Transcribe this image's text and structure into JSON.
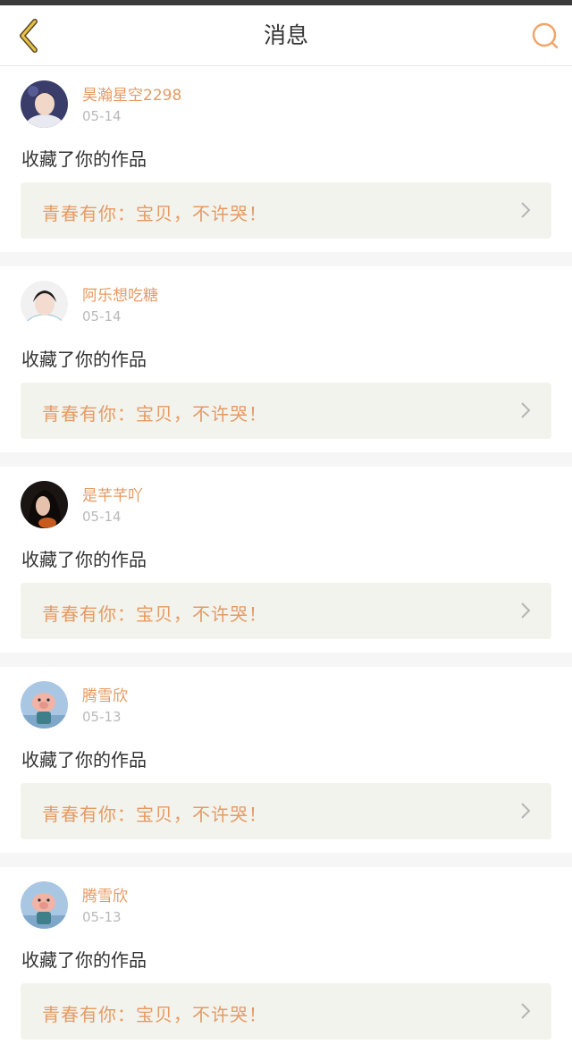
{
  "header": {
    "title": "消息"
  },
  "messages": [
    {
      "user": "昊瀚星空2298",
      "date": "05-14",
      "action": "收藏了你的作品",
      "work": "青春有你：宝贝，不许哭！"
    },
    {
      "user": "阿乐想吃糖",
      "date": "05-14",
      "action": "收藏了你的作品",
      "work": "青春有你：宝贝，不许哭！"
    },
    {
      "user": "是芊芊吖",
      "date": "05-14",
      "action": "收藏了你的作品",
      "work": "青春有你：宝贝，不许哭！"
    },
    {
      "user": "腾雪欣",
      "date": "05-13",
      "action": "收藏了你的作品",
      "work": "青春有你：宝贝，不许哭！"
    },
    {
      "user": "腾雪欣",
      "date": "05-13",
      "action": "收藏了你的作品",
      "work": "青春有你：宝贝，不许哭！"
    }
  ],
  "colors": {
    "accent": "#e59a63",
    "card_bg": "#f3f3ed",
    "back_icon": "#e0b040"
  },
  "icons": {
    "back": "chevron-left-icon",
    "search": "search-icon",
    "forward": "chevron-right-icon"
  }
}
